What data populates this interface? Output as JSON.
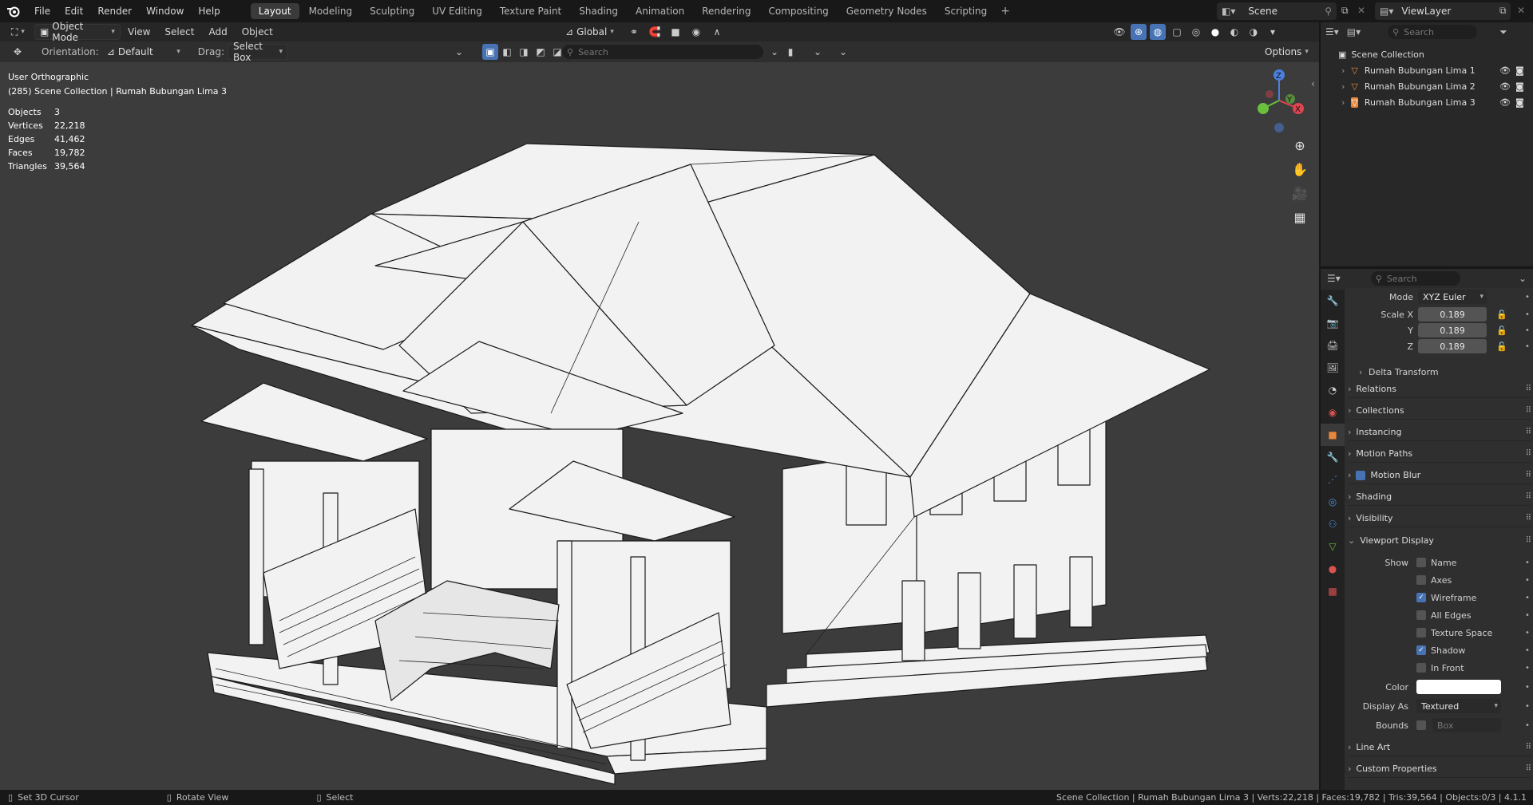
{
  "menubar": {
    "items": [
      "File",
      "Edit",
      "Render",
      "Window",
      "Help"
    ],
    "workspaces": [
      "Layout",
      "Modeling",
      "Sculpting",
      "UV Editing",
      "Texture Paint",
      "Shading",
      "Animation",
      "Rendering",
      "Compositing",
      "Geometry Nodes",
      "Scripting"
    ],
    "active_workspace": "Layout",
    "scene": "Scene",
    "view_layer": "ViewLayer"
  },
  "header": {
    "mode": "Object Mode",
    "menus": [
      "View",
      "Select",
      "Add",
      "Object"
    ],
    "orientation_dd": "Global"
  },
  "toolbar": {
    "orientation_label": "Orientation:",
    "orientation_value": "Default",
    "drag_label": "Drag:",
    "drag_value": "Select Box",
    "search_placeholder": "Search",
    "options": "Options"
  },
  "viewport": {
    "view_name": "User Orthographic",
    "collection_line": "(285) Scene Collection | Rumah Bubungan Lima 3",
    "stats": [
      {
        "k": "Objects",
        "v": "3"
      },
      {
        "k": "Vertices",
        "v": "22,218"
      },
      {
        "k": "Edges",
        "v": "41,462"
      },
      {
        "k": "Faces",
        "v": "19,782"
      },
      {
        "k": "Triangles",
        "v": "39,564"
      }
    ],
    "gizmo": {
      "x": "X",
      "y": "Y",
      "z": "Z"
    }
  },
  "outliner": {
    "search_placeholder": "Search",
    "root": "Scene Collection",
    "items": [
      "Rumah Bubungan Lima 1",
      "Rumah Bubungan Lima 2",
      "Rumah Bubungan Lima 3"
    ]
  },
  "properties": {
    "search_placeholder": "Search",
    "mode_label": "Mode",
    "mode_value": "XYZ Euler",
    "scale": [
      {
        "label": "Scale X",
        "value": "0.189"
      },
      {
        "label": "Y",
        "value": "0.189"
      },
      {
        "label": "Z",
        "value": "0.189"
      }
    ],
    "delta": "Delta Transform",
    "panels": [
      "Relations",
      "Collections",
      "Instancing",
      "Motion Paths",
      "Motion Blur",
      "Shading",
      "Visibility"
    ],
    "viewport_display": {
      "title": "Viewport Display",
      "show_label": "Show",
      "checks": [
        {
          "label": "Name",
          "on": false
        },
        {
          "label": "Axes",
          "on": false
        },
        {
          "label": "Wireframe",
          "on": true
        },
        {
          "label": "All Edges",
          "on": false
        },
        {
          "label": "Texture Space",
          "on": false
        },
        {
          "label": "Shadow",
          "on": true
        },
        {
          "label": "In Front",
          "on": false
        }
      ],
      "color_label": "Color",
      "display_as_label": "Display As",
      "display_as_value": "Textured",
      "bounds_label": "Bounds",
      "bounds_value": "Box"
    },
    "footer_panels": [
      "Line Art",
      "Custom Properties"
    ]
  },
  "statusbar": {
    "left": [
      {
        "icon": "mouse-left-icon",
        "text": "Set 3D Cursor"
      },
      {
        "icon": "mouse-middle-icon",
        "text": "Rotate View"
      },
      {
        "icon": "mouse-right-icon",
        "text": "Select"
      }
    ],
    "right": "Scene Collection | Rumah Bubungan Lima 3 | Verts:22,218 | Faces:19,782 | Tris:39,564 | Objects:0/3 | 4.1.1"
  },
  "colors": {
    "accent": "#4772b3",
    "viewport_bg": "#3c3c3c",
    "model_fill": "#f2f2f2",
    "object_orange": "#e8873a"
  }
}
